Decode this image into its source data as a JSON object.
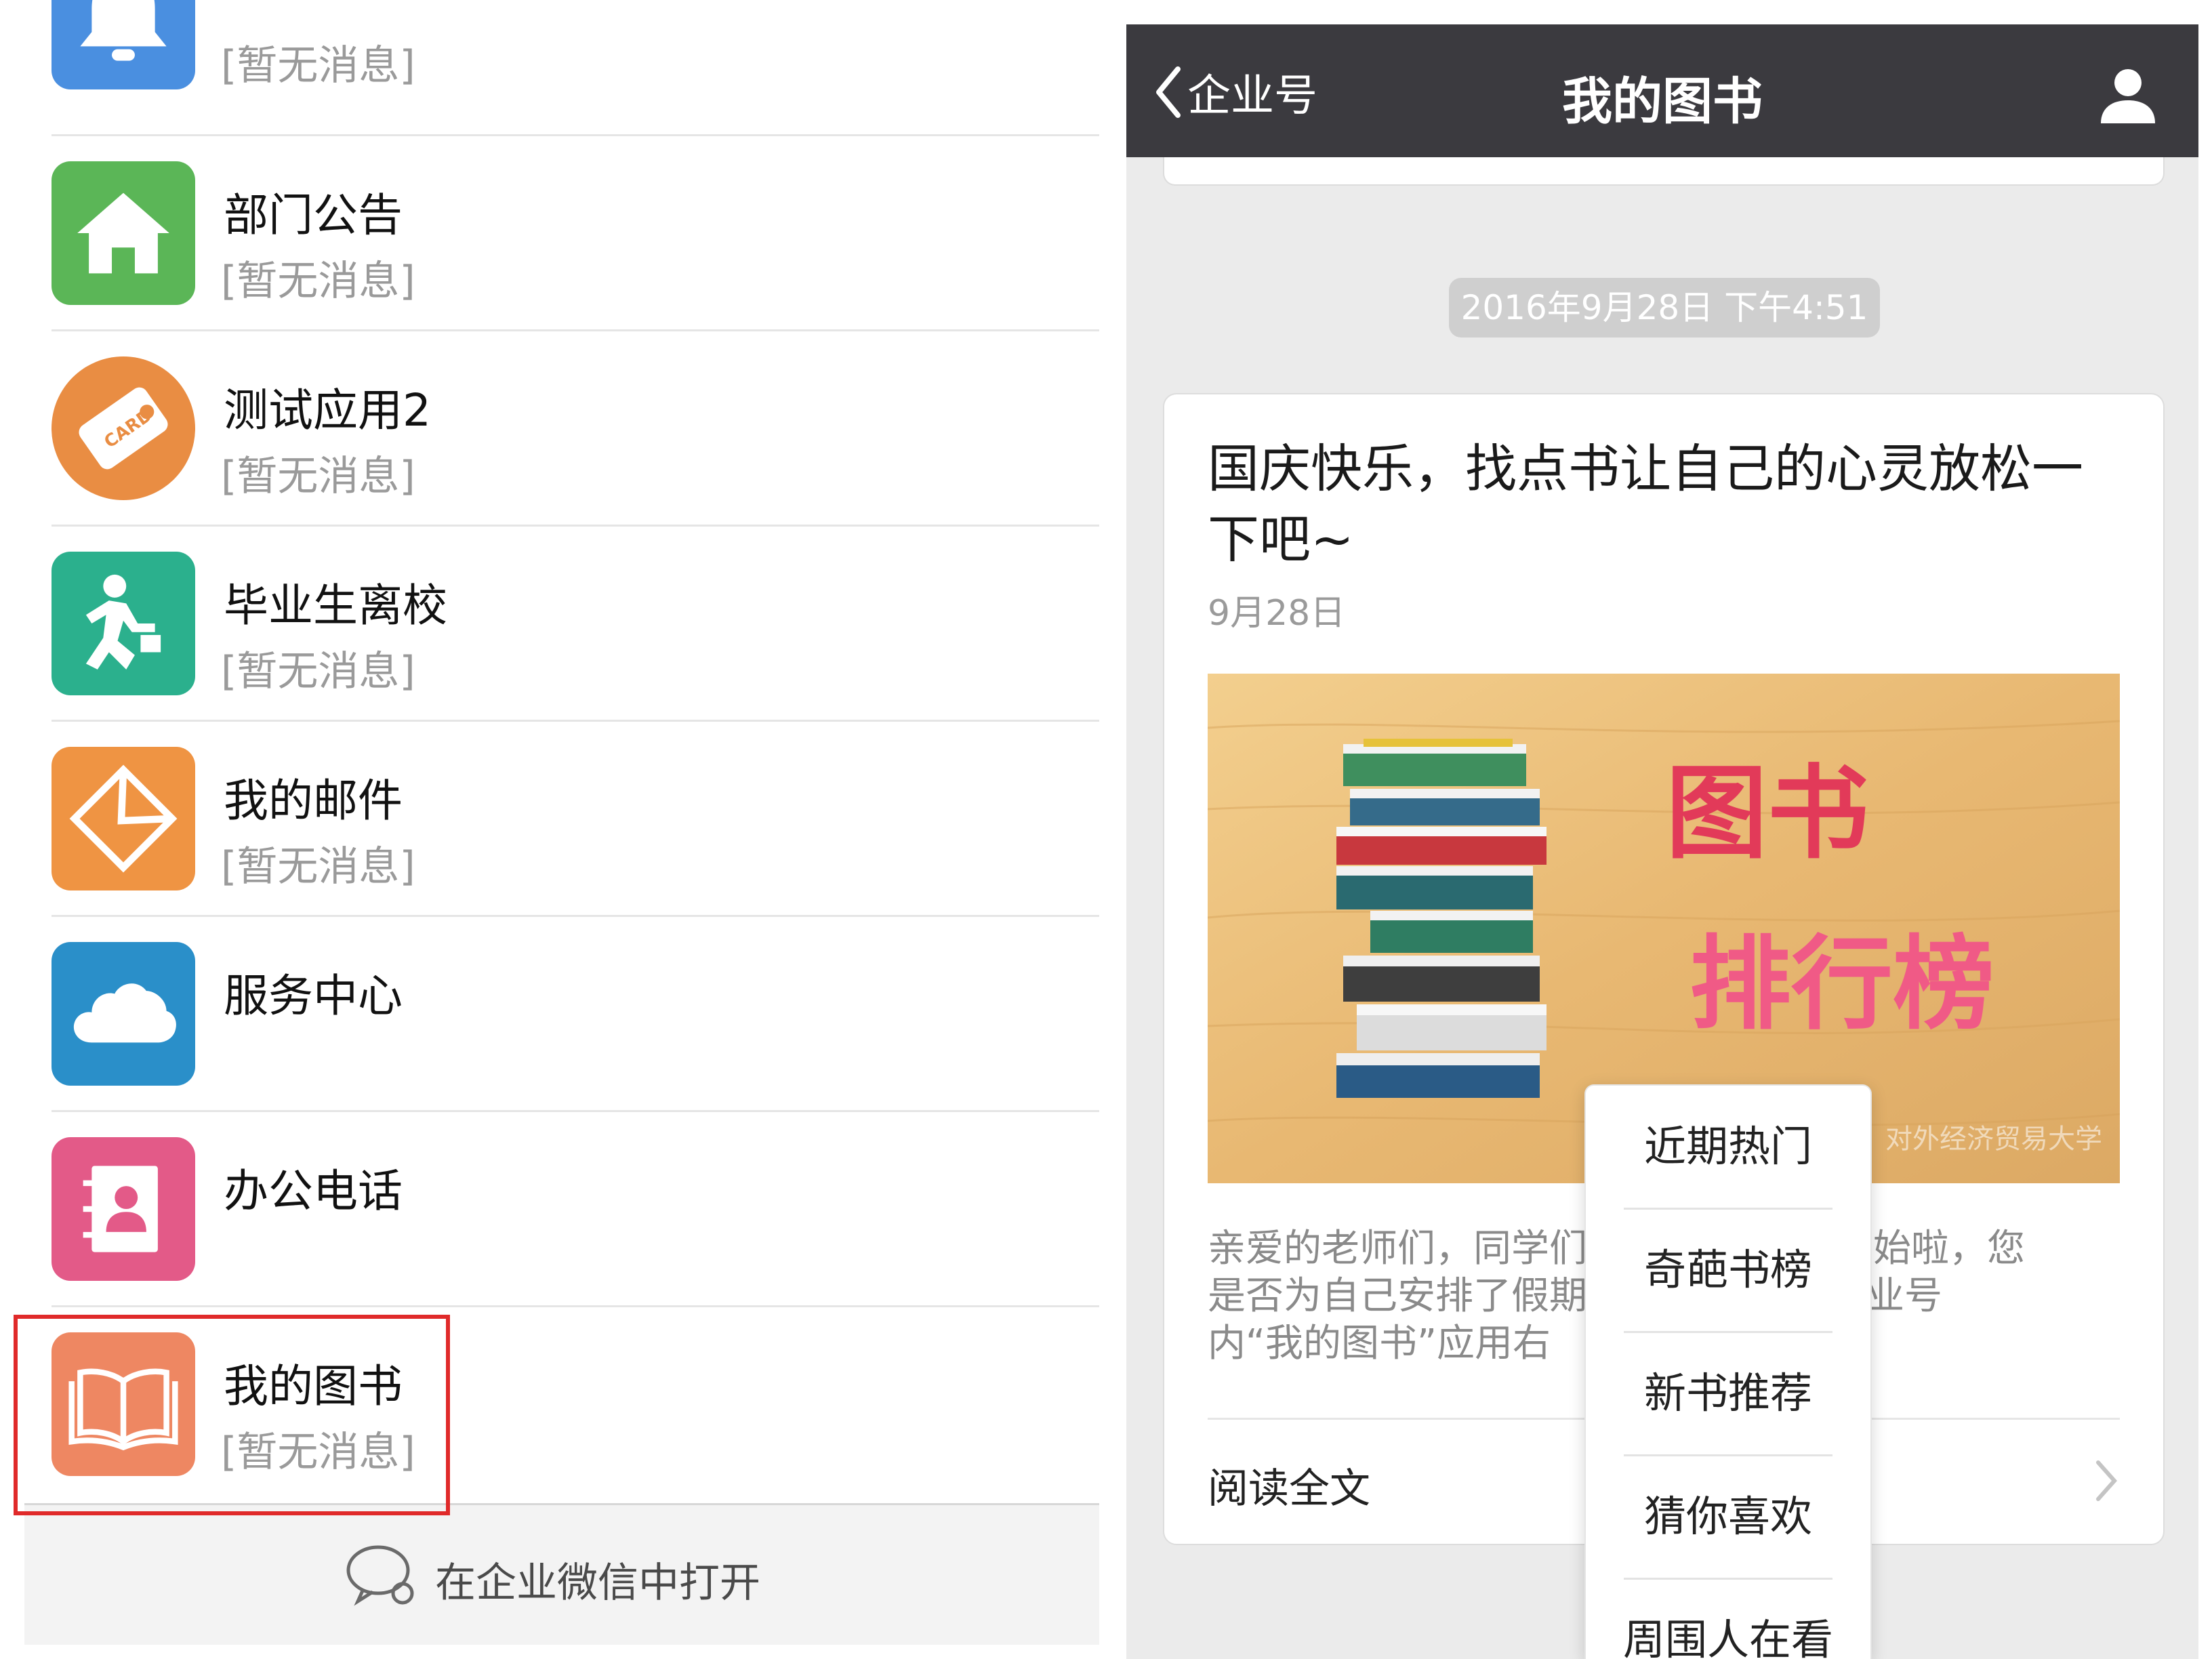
{
  "left": {
    "rows": [
      {
        "name": "",
        "sub": "[暂无消息]",
        "icon": "bell-icon",
        "color": "#4a8fe0"
      },
      {
        "name": "部门公告",
        "sub": "[暂无消息]",
        "icon": "house-icon",
        "color": "#5bb657"
      },
      {
        "name": "测试应用2",
        "sub": "[暂无消息]",
        "icon": "card-icon",
        "color": "#e98d43"
      },
      {
        "name": "毕业生离校",
        "sub": "[暂无消息]",
        "icon": "running-man-icon",
        "color": "#2bb08d"
      },
      {
        "name": "我的邮件",
        "sub": "[暂无消息]",
        "icon": "mail-icon",
        "color": "#ef9443"
      },
      {
        "name": "服务中心",
        "sub": "",
        "icon": "cloud-icon",
        "color": "#2a8fc9"
      },
      {
        "name": "办公电话",
        "sub": "",
        "icon": "contacts-book-icon",
        "color": "#e35a88"
      },
      {
        "name": "我的图书",
        "sub": "[暂无消息]",
        "icon": "open-book-icon",
        "color": "#ee8762"
      }
    ],
    "footer": {
      "label": "在企业微信中打开",
      "icon": "chat-bubbles-icon"
    },
    "highlight_color": "#e02a2a"
  },
  "right": {
    "nav": {
      "back_label": "企业号",
      "title": "我的图书",
      "back_icon": "chevron-left-icon",
      "profile_icon": "person-icon"
    },
    "timestamp": "2016年9月28日 下午4:51",
    "article": {
      "title": "国庆快乐，找点书让自己的心灵放松一下吧~",
      "date": "9月28日",
      "cover": {
        "line1": "图书",
        "line2": "排行榜",
        "watermark": "对外经济贸易大学"
      },
      "excerpt_lines": [
        "亲爱的老师们，同学们",
        "要开始啦，您",
        "是否为自己安排了假期",
        "击企业号",
        "内“我的图书”应用右"
      ],
      "read_more": "阅读全文"
    },
    "menu": {
      "items": [
        "近期热门",
        "奇葩书榜",
        "新书推荐",
        "猜你喜欢",
        "周围人在看"
      ]
    }
  }
}
